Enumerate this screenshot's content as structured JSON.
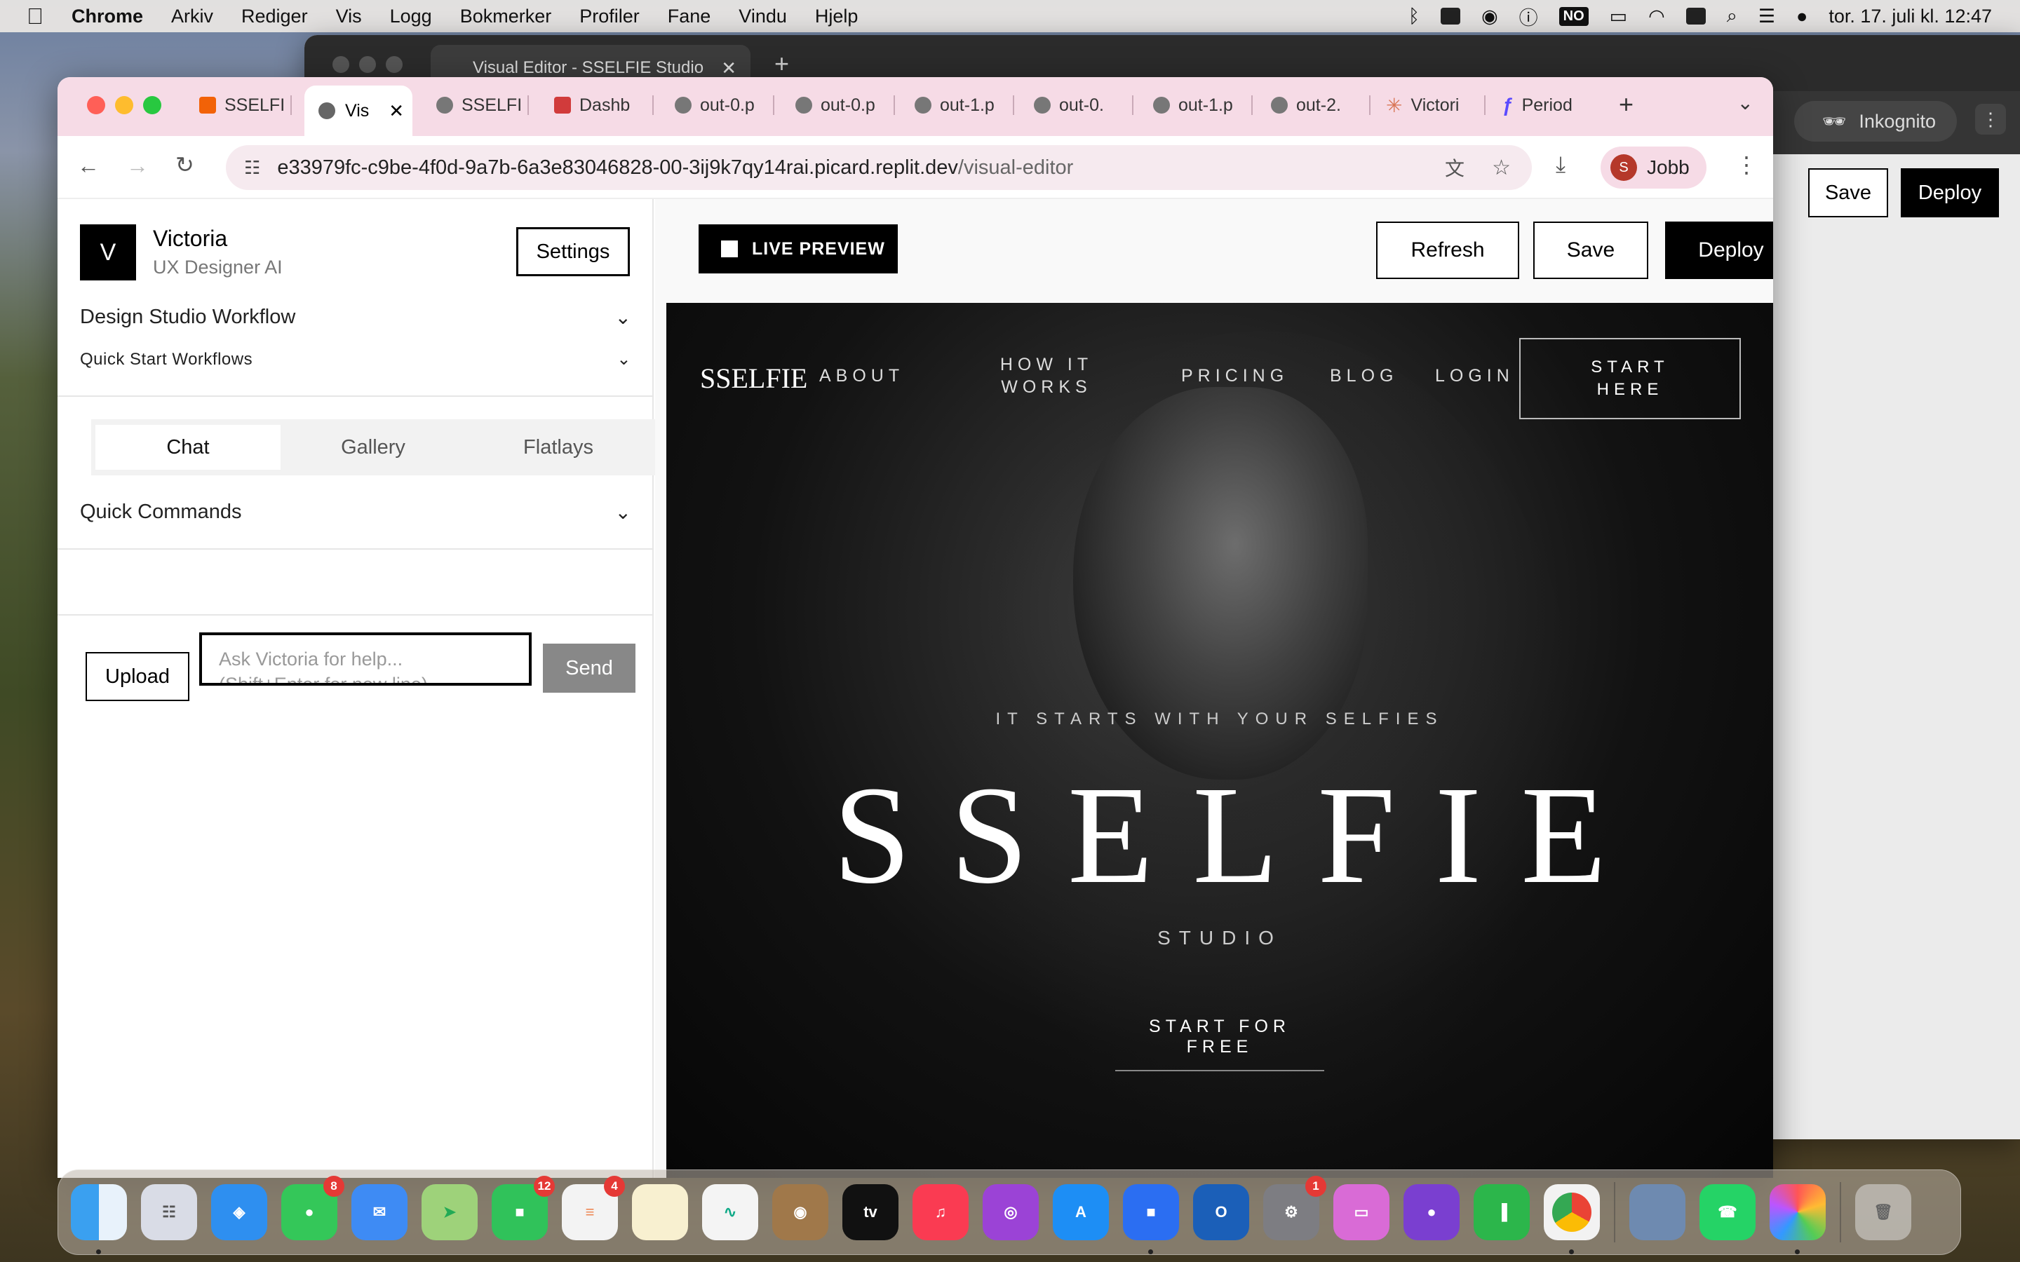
{
  "menubar": {
    "app": "Chrome",
    "items": [
      "Arkiv",
      "Rediger",
      "Vis",
      "Logg",
      "Bokmerker",
      "Profiler",
      "Fane",
      "Vindu",
      "Hjelp"
    ],
    "input_badge": "NO",
    "clock": "tor. 17. juli kl. 12:47"
  },
  "back_window": {
    "tab_title": "Visual Editor - SSELFIE Studio",
    "incognito": "Inkognito",
    "button_partial": "n",
    "save": "Save",
    "deploy": "Deploy"
  },
  "tabs": [
    {
      "label": "SSELFI",
      "icon": "replit-icon",
      "color": "#f26207"
    },
    {
      "label": "Vis",
      "icon": "globe-icon",
      "active": true
    },
    {
      "label": "SSELFI",
      "icon": "globe-icon"
    },
    {
      "label": "Dashb",
      "icon": "dashboard-icon",
      "color": "#d13b3b"
    },
    {
      "label": "out-0.p",
      "icon": "globe-icon"
    },
    {
      "label": "out-0.p",
      "icon": "globe-icon"
    },
    {
      "label": "out-1.p",
      "icon": "globe-icon"
    },
    {
      "label": "out-0.",
      "icon": "globe-icon"
    },
    {
      "label": "out-1.p",
      "icon": "globe-icon"
    },
    {
      "label": "out-2.",
      "icon": "globe-icon"
    },
    {
      "label": "Victori",
      "icon": "claude-icon",
      "color": "#d97757"
    },
    {
      "label": "Period",
      "icon": "f-icon",
      "color": "#5b4bff"
    }
  ],
  "omnibox": {
    "host": "e33979fc-c9be-4f0d-9a7b-6a3e83046828-00-3ij9k7qy14rai.picard.replit.dev",
    "path": "/visual-editor"
  },
  "profile": {
    "initial": "S",
    "name": "Jobb"
  },
  "sidebar": {
    "avatar_letter": "V",
    "name": "Victoria",
    "role": "UX Designer AI",
    "settings": "Settings",
    "workflow": "Design Studio Workflow",
    "quick_start": "Quick Start Workflows",
    "tabs": [
      "Chat",
      "Gallery",
      "Flatlays"
    ],
    "quick_commands": "Quick Commands",
    "upload": "Upload",
    "input_placeholder": "Ask Victoria for help...",
    "input_hint": "(Shift+Enter for new line)",
    "send": "Send"
  },
  "editor": {
    "live_preview": "LIVE PREVIEW",
    "refresh": "Refresh",
    "save": "Save",
    "deploy": "Deploy"
  },
  "preview": {
    "logo": "SSELFIE",
    "nav": [
      "ABOUT",
      "HOW IT WORKS",
      "PRICING",
      "BLOG",
      "LOGIN"
    ],
    "nav_how_1": "HOW IT",
    "nav_how_2": "WORKS",
    "cta_1": "START",
    "cta_2": "HERE",
    "tagline": "IT STARTS WITH YOUR SELFIES",
    "headline": "SSELFIE",
    "sub": "STUDIO",
    "start_free": "START FOR FREE"
  },
  "dock": {
    "badges": {
      "messages": "8",
      "facetime": "12",
      "reminders": "4",
      "settings": "1"
    }
  }
}
